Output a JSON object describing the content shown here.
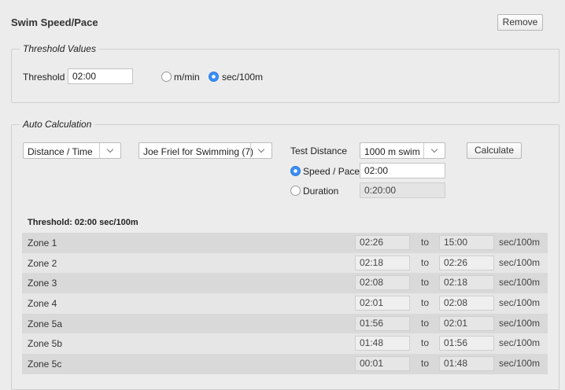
{
  "page": {
    "title": "Swim Speed/Pace",
    "remove_label": "Remove"
  },
  "threshold_values": {
    "legend": "Threshold Values",
    "threshold_label": "Threshold",
    "threshold_value": "02:00",
    "unit_options": [
      {
        "label": "m/min",
        "selected": false
      },
      {
        "label": "sec/100m",
        "selected": true
      }
    ]
  },
  "auto_calc": {
    "legend": "Auto Calculation",
    "method_select": "Distance / Time",
    "profile_select": "Joe Friel for Swimming (7)",
    "test_distance_label": "Test Distance",
    "test_distance_select": "1000 m swim",
    "calculate_label": "Calculate",
    "speed_pace_label": "Speed / Pace",
    "speed_pace_value": "02:00",
    "speed_pace_selected": true,
    "duration_label": "Duration",
    "duration_value": "0:20:00",
    "duration_selected": false
  },
  "zones": {
    "summary": "Threshold: 02:00 sec/100m",
    "to_label": "to",
    "unit": "sec/100m",
    "rows": [
      {
        "name": "Zone 1",
        "from": "02:26",
        "to": "15:00"
      },
      {
        "name": "Zone 2",
        "from": "02:18",
        "to": "02:26"
      },
      {
        "name": "Zone 3",
        "from": "02:08",
        "to": "02:18"
      },
      {
        "name": "Zone 4",
        "from": "02:01",
        "to": "02:08"
      },
      {
        "name": "Zone 5a",
        "from": "01:56",
        "to": "02:01"
      },
      {
        "name": "Zone 5b",
        "from": "01:48",
        "to": "01:56"
      },
      {
        "name": "Zone 5c",
        "from": "00:01",
        "to": "01:48"
      }
    ]
  },
  "colors": {
    "accent": "#3b8ef3",
    "background": "#ececec",
    "row_dark": "#d9d9d9",
    "row_light": "#e6e6e6"
  }
}
